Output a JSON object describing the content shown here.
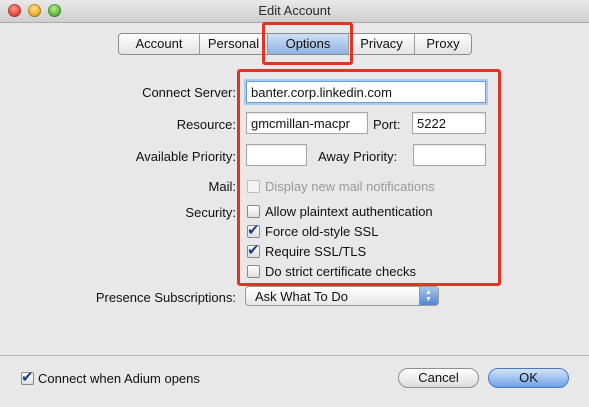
{
  "window": {
    "title": "Edit Account"
  },
  "tabs": [
    {
      "label": "Account"
    },
    {
      "label": "Personal"
    },
    {
      "label": "Options"
    },
    {
      "label": "Privacy"
    },
    {
      "label": "Proxy"
    }
  ],
  "selected_tab": "Options",
  "form": {
    "connect_server_label": "Connect Server:",
    "connect_server_value": "banter.corp.linkedin.com",
    "resource_label": "Resource:",
    "resource_value": "gmcmillan-macpr",
    "port_label": "Port:",
    "port_value": "5222",
    "available_priority_label": "Available Priority:",
    "available_priority_value": "",
    "away_priority_label": "Away Priority:",
    "away_priority_value": "",
    "mail_label": "Mail:",
    "mail_option": {
      "label": "Display new mail notifications",
      "checked": false,
      "enabled": false
    },
    "security_label": "Security:",
    "security_options": [
      {
        "label": "Allow plaintext authentication",
        "checked": false
      },
      {
        "label": "Force old-style SSL",
        "checked": true
      },
      {
        "label": "Require SSL/TLS",
        "checked": true
      },
      {
        "label": "Do strict certificate checks",
        "checked": false
      }
    ],
    "presence_label": "Presence Subscriptions:",
    "presence_value": "Ask What To Do"
  },
  "footer": {
    "connect_when_opens": {
      "label": "Connect when Adium opens",
      "checked": true
    },
    "cancel_label": "Cancel",
    "ok_label": "OK"
  },
  "colors": {
    "highlight": "#e63224",
    "selected_tab": "#8eb2e2",
    "default_button": "#6fa0e6"
  }
}
